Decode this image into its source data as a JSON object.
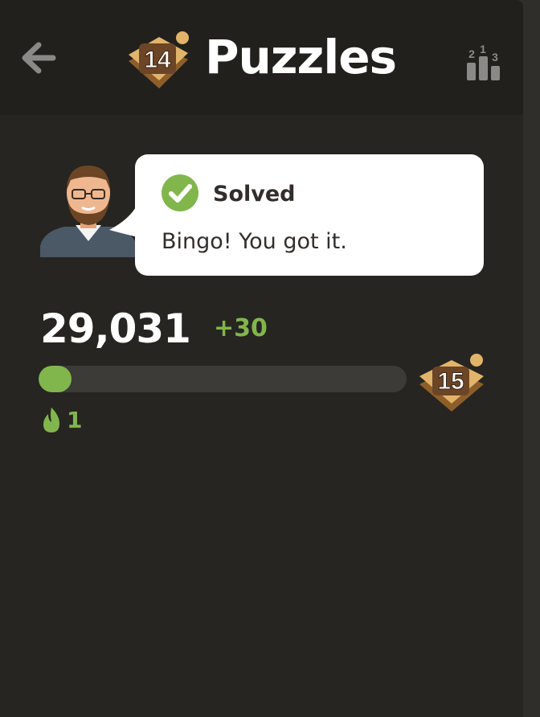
{
  "header": {
    "title": "Puzzles",
    "level_badge": "14",
    "back_icon": "arrow-left-icon",
    "leaderboard_icon": "podium-icon",
    "leaderboard_digits": [
      "2",
      "1",
      "3"
    ]
  },
  "feedback": {
    "status": "Solved",
    "message": "Bingo! You got it.",
    "status_icon": "check-circle-icon",
    "coach_avatar": "coach-avatar"
  },
  "rating": {
    "score": "29,031",
    "delta": "+30",
    "progress_fraction": 0.09,
    "next_level_badge": "15"
  },
  "streak": {
    "icon": "flame-icon",
    "count": "1"
  },
  "colors": {
    "accent_green": "#81b64c",
    "background": "#262522",
    "header_bg": "#21201d",
    "badge_gold": "#e2b46a"
  }
}
